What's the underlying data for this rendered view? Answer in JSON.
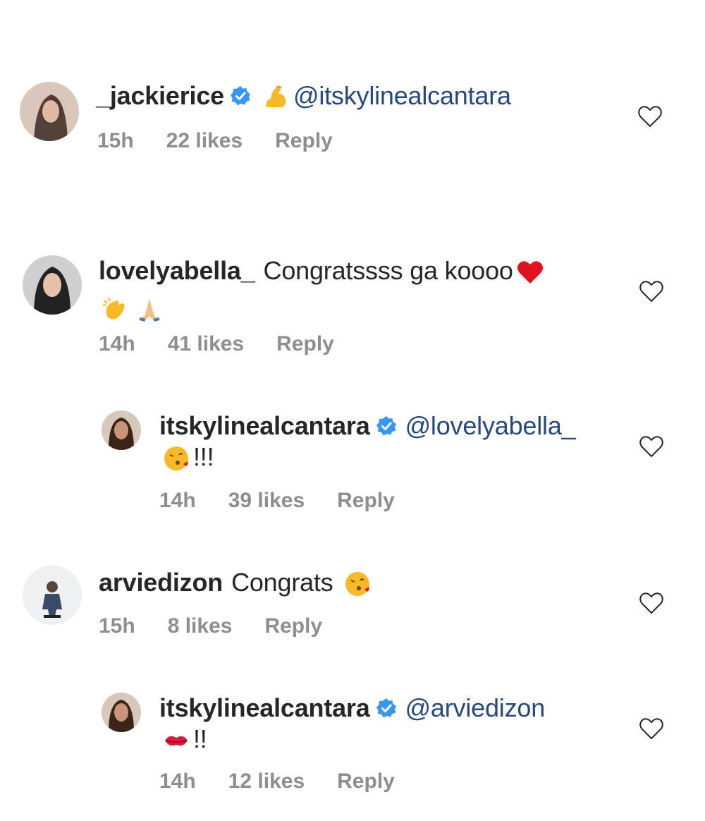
{
  "comments": [
    {
      "username": "_jackierice",
      "verified": true,
      "line1_mention": "@itskylinealcantara",
      "line1_text": "",
      "line1_emoji": "flexed-biceps",
      "line2_text": "",
      "time": "15h",
      "likes": "22 likes",
      "reply": "Reply"
    },
    {
      "username": "lovelyabella_",
      "verified": false,
      "line1_text": "Congratssss ga koooo",
      "line1_emoji": "red-heart",
      "line2_emoji": [
        "clapping-hands",
        "folded-hands"
      ],
      "time": "14h",
      "likes": "41 likes",
      "reply": "Reply"
    },
    {
      "username": "itskylinealcantara",
      "verified": true,
      "line1_mention": "@lovelyabella_",
      "line2_emoji": "face-blowing-kiss",
      "line2_text": "!!!",
      "time": "14h",
      "likes": "39 likes",
      "reply": "Reply"
    },
    {
      "username": "arviedizon",
      "verified": false,
      "line1_text": "Congrats",
      "line1_emoji": "face-blowing-kiss",
      "time": "15h",
      "likes": "8 likes",
      "reply": "Reply"
    },
    {
      "username": "itskylinealcantara",
      "verified": true,
      "line1_mention": "@arviedizon",
      "line2_emoji": "kiss-mark",
      "line2_text": "!!",
      "time": "14h",
      "likes": "12 likes",
      "reply": "Reply"
    }
  ],
  "colors": {
    "mention": "#27487a",
    "meta": "#8e8e8e",
    "verified": "#3897f0"
  }
}
